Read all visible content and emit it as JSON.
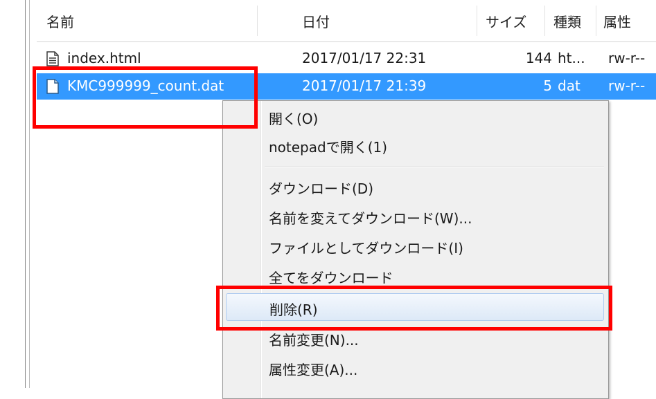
{
  "header": {
    "col_name": "名前",
    "col_date": "日付",
    "col_size": "サイズ",
    "col_type": "種類",
    "col_attr": "属性"
  },
  "files": [
    {
      "name": "index.html",
      "date": "2017/01/17 22:31",
      "size": "144",
      "type": "ht...",
      "attr": "rw-r--",
      "icon": "text-file-icon"
    },
    {
      "name": "KMC999999_count.dat",
      "date": "2017/01/17 21:39",
      "size": "5",
      "type": "dat",
      "attr": "rw-r--",
      "icon": "blank-file-icon",
      "selected": true
    }
  ],
  "context_menu": {
    "open": "開く(O)",
    "open_notepad": "notepadで開く(1)",
    "download": "ダウンロード(D)",
    "rename_download": "名前を変えてダウンロード(W)...",
    "download_as_file": "ファイルとしてダウンロード(I)",
    "download_all": "全てをダウンロード",
    "delete": "削除(R)",
    "rename": "名前変更(N)...",
    "change_attr": "属性変更(A)..."
  },
  "colors": {
    "selection": "#3399ff",
    "highlight_box": "#ff0000"
  }
}
